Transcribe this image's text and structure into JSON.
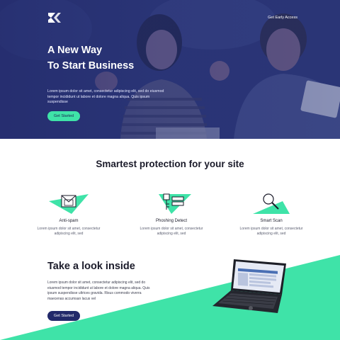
{
  "hero": {
    "nav_link": "Get Early Access",
    "title_line1": "A New Way",
    "title_line2": "To Start Business",
    "text": "Lorem ipsum dolor sit amet, consectetur adipiscing elit, sed do eiusmod tempor incididunt ut labore et dolore magna aliqua. Quis ipsum suspendisse",
    "button": "Get Started"
  },
  "features": {
    "title": "Smartest protection for your site",
    "items": [
      {
        "icon": "envelope-icon",
        "title": "Anti-spam",
        "text": "Lorem ipsum dolor sit amet, consectetur adipiscing elit, sed"
      },
      {
        "icon": "key-icon",
        "title": "Phoshing Detect",
        "text": "Lorem ipsum dolor sit amet, consectetur adipiscing elit, sed"
      },
      {
        "icon": "magnifier-icon",
        "title": "Smart Scan",
        "text": "Lorem ipsum dolor sit amet, consectetur adipiscing elit, sed"
      }
    ]
  },
  "inside": {
    "title": "Take a look inside",
    "text": "Lorem ipsum dolor sit amet, consectetur adipiscing elit, sed do eiusmod tempor incididunt ut labore et dolore magna aliqua. Quis ipsum suspendisse ultrices gravida. Risus commodo viverra maecenas accumsan lacus vel",
    "button": "Get Started"
  },
  "colors": {
    "navy": "#22296a",
    "accent_green": "#3fe3a8",
    "hero_overlay": "#2a3478"
  }
}
